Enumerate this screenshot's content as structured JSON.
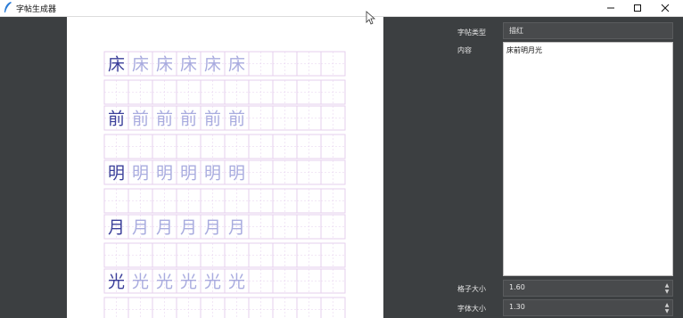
{
  "window": {
    "title": "字帖生成器"
  },
  "panel": {
    "type_label": "字帖类型",
    "type_value": "描红",
    "content_label": "内容",
    "content_value": "床前明月光",
    "grid_size_label": "格子大小",
    "grid_size_value": "1.60",
    "font_size_label": "字体大小",
    "font_size_value": "1.30"
  },
  "sheet": {
    "characters": [
      "床",
      "前",
      "明",
      "月",
      "光"
    ],
    "trace_copies": 5,
    "columns": 10,
    "model_color": "#3b3f9a",
    "trace_color": "#a9acdf",
    "grid_color": "#e6cfee"
  }
}
